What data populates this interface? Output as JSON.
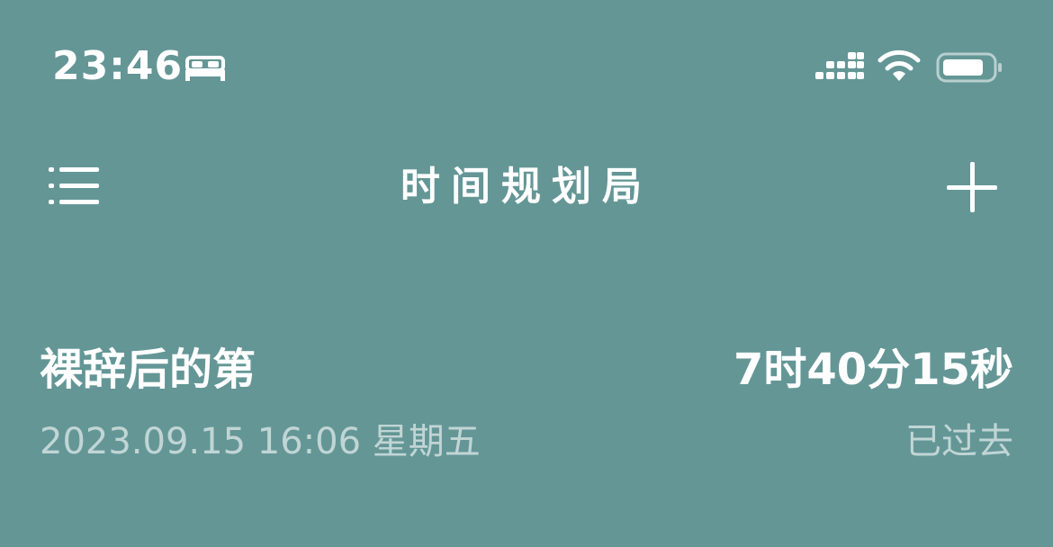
{
  "status_bar": {
    "time": "23:46",
    "focus_icon": "bed-icon",
    "signal_icon": "cellular-signal-icon",
    "wifi_icon": "wifi-icon",
    "battery_icon": "battery-icon"
  },
  "nav": {
    "title": "时间规划局",
    "menu_icon": "menu-icon",
    "add_icon": "plus-icon"
  },
  "events": [
    {
      "title": "裸辞后的第",
      "elapsed": "7时40分15秒",
      "date": "2023.09.15 16:06 星期五",
      "status": "已过去"
    }
  ],
  "colors": {
    "background": "#649696",
    "text": "#ffffff",
    "secondary_text": "rgba(255,255,255,0.6)"
  }
}
